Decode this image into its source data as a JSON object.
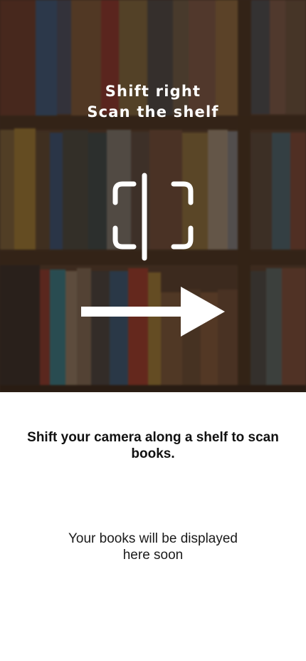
{
  "camera": {
    "hint_line1": "Shift right",
    "hint_line2": "Scan the shelf",
    "scan_icon": "scan-frame-icon",
    "direction_icon": "arrow-right-icon"
  },
  "panel": {
    "instruction": "Shift your camera along a shelf to scan books.",
    "placeholder": "Your books will be displayed here soon"
  },
  "colors": {
    "overlay_text": "#ffffff",
    "shelf_wood": "#5a3f2a",
    "panel_bg": "#ffffff",
    "body_text": "#111111"
  }
}
